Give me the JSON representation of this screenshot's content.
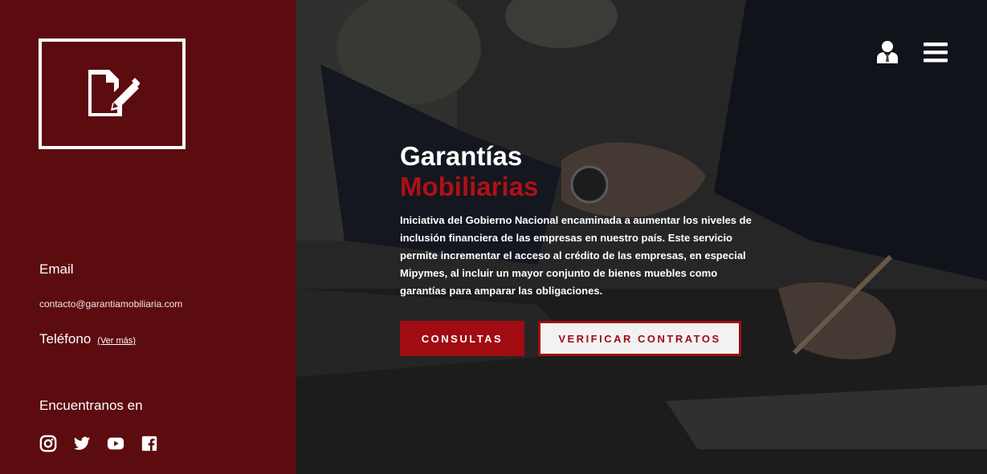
{
  "sidebar": {
    "logo_icon": "signed-document-icon",
    "email_label": "Email",
    "email_value": "contacto@garantiamobiliaria.com",
    "phone_label": "Teléfono",
    "phone_link": "(Ver más)",
    "find_label": "Encuentranos en",
    "social": [
      {
        "icon": "instagram-icon"
      },
      {
        "icon": "twitter-icon"
      },
      {
        "icon": "youtube-icon"
      },
      {
        "icon": "facebook-icon"
      }
    ]
  },
  "header": {
    "user_icon": "user-icon",
    "menu_icon": "hamburger-menu-icon"
  },
  "hero": {
    "title_line1": "Garantías",
    "title_line2": "Mobiliarias",
    "description": "Iniciativa del Gobierno Nacional encaminada a aumentar los niveles de inclusión financiera de las empresas en nuestro país. Este servicio permite incrementar el acceso al crédito de las empresas, en especial Mipymes, al incluir un mayor conjunto de bienes muebles como garantías para amparar las obligaciones.",
    "btn_consultas": "CONSULTAS",
    "btn_verificar": "VERIFICAR CONTRATOS"
  },
  "colors": {
    "sidebar_bg": "#5c0b0f",
    "accent": "#a00c12",
    "title_accent": "#b01016"
  }
}
